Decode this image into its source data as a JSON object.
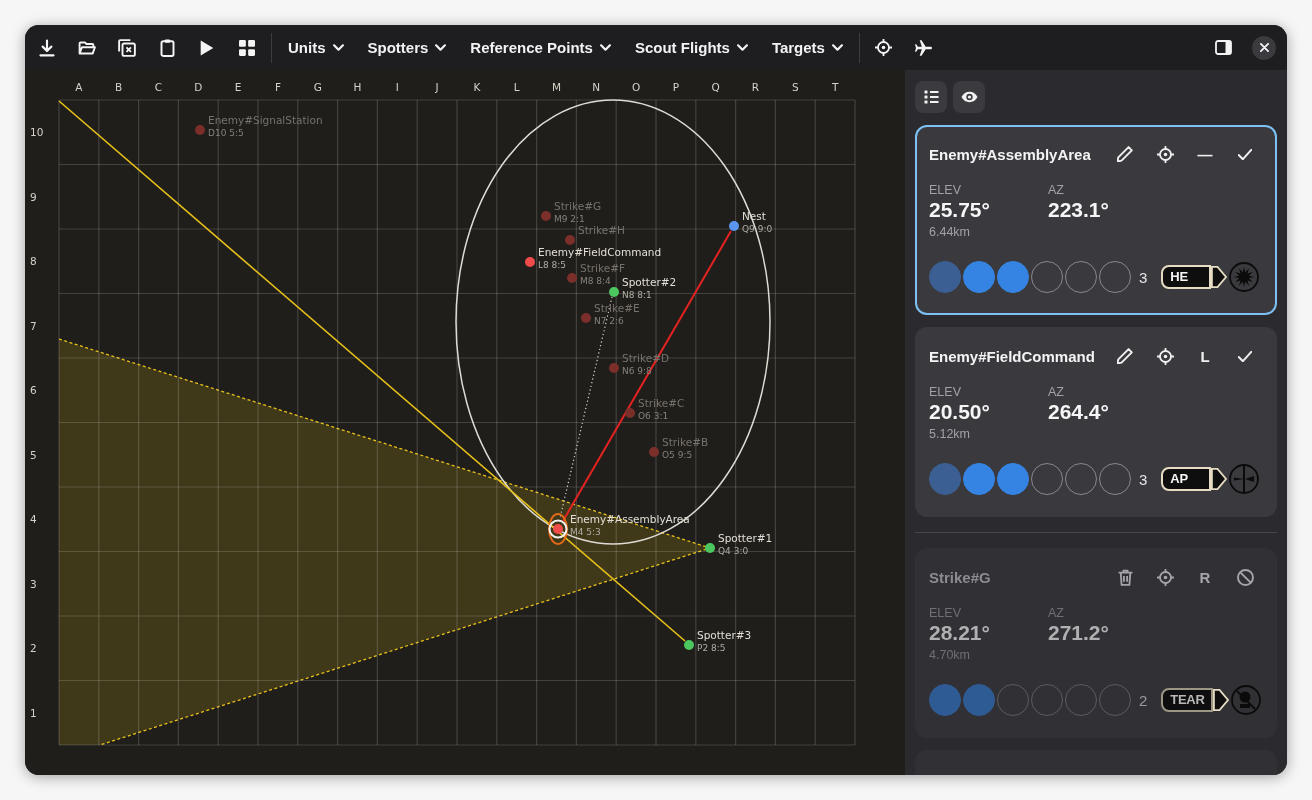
{
  "toolbar": {
    "menus": [
      {
        "label": "Units"
      },
      {
        "label": "Spotters"
      },
      {
        "label": "Reference Points"
      },
      {
        "label": "Scout Flights"
      },
      {
        "label": "Targets"
      }
    ]
  },
  "map": {
    "columns": [
      "A",
      "B",
      "C",
      "D",
      "E",
      "F",
      "G",
      "H",
      "I",
      "J",
      "K",
      "L",
      "M",
      "N",
      "O",
      "P",
      "Q",
      "R",
      "S",
      "T"
    ],
    "rows": [
      "10",
      "9",
      "8",
      "7",
      "6",
      "5",
      "4",
      "3",
      "2",
      "1"
    ],
    "markers": [
      {
        "name": "Enemy#SignalStation",
        "grid": "D10 5:5",
        "color": "#7a2f2b",
        "dimmed": true,
        "selected": false
      },
      {
        "name": "Strike#G",
        "grid": "M9 2:1",
        "color": "#7a2f2b",
        "dimmed": true,
        "selected": false
      },
      {
        "name": "Strike#H",
        "color": "#7a2f2b",
        "dimmed": true,
        "selected": false
      },
      {
        "name": "Enemy#FieldCommand",
        "grid": "L8 8:5",
        "color": "#ef4b4b",
        "dimmed": false,
        "selected": false
      },
      {
        "name": "Strike#F",
        "grid": "M8 8:4",
        "color": "#7a2f2b",
        "dimmed": true,
        "selected": false
      },
      {
        "name": "Spotter#2",
        "grid": "N8 8:1",
        "color": "#4cc760",
        "dimmed": false,
        "selected": false
      },
      {
        "name": "Strike#E",
        "grid": "N7 2:6",
        "color": "#7a2f2b",
        "dimmed": true,
        "selected": false
      },
      {
        "name": "Strike#D",
        "grid": "N6 9:8",
        "color": "#7a2f2b",
        "dimmed": true,
        "selected": false
      },
      {
        "name": "Strike#C",
        "grid": "O6 3:1",
        "color": "#7a2f2b",
        "dimmed": true,
        "selected": false
      },
      {
        "name": "Strike#B",
        "grid": "O5 9:5",
        "color": "#7a2f2b",
        "dimmed": true,
        "selected": false
      },
      {
        "name": "Nest",
        "grid": "Q9 9:0",
        "color": "#5a96f0",
        "dimmed": false,
        "selected": false
      },
      {
        "name": "Enemy#AssemblyArea",
        "grid": "M4 5:3",
        "color": "#ef4b4b",
        "dimmed": false,
        "selected": true
      },
      {
        "name": "Spotter#1",
        "grid": "Q4 3:0",
        "color": "#4cc760",
        "dimmed": false,
        "selected": false
      },
      {
        "name": "Spotter#3",
        "grid": "P2 8:5",
        "color": "#4cc760",
        "dimmed": false,
        "selected": false
      }
    ]
  },
  "panel": {
    "cards": [
      {
        "title": "Enemy#AssemblyArea",
        "kind": "target",
        "selected": true,
        "disabled": false,
        "side": "—",
        "elev_label": "ELEV",
        "elev": "25.75°",
        "range": "6.44km",
        "az_label": "AZ",
        "az": "223.1°",
        "slots": [
          {
            "filled": true,
            "fired": true
          },
          {
            "filled": true,
            "fired": false
          },
          {
            "filled": true,
            "fired": false
          },
          {
            "filled": false,
            "fired": false
          },
          {
            "filled": false,
            "fired": false
          },
          {
            "filled": false,
            "fired": false
          }
        ],
        "count": "3",
        "ammo": {
          "label": "HE",
          "kind": "explosive"
        }
      },
      {
        "title": "Enemy#FieldCommand",
        "kind": "target",
        "selected": false,
        "disabled": false,
        "side": "L",
        "elev_label": "ELEV",
        "elev": "20.50°",
        "range": "5.12km",
        "az_label": "AZ",
        "az": "264.4°",
        "slots": [
          {
            "filled": true,
            "fired": true
          },
          {
            "filled": true,
            "fired": false
          },
          {
            "filled": true,
            "fired": false
          },
          {
            "filled": false,
            "fired": false
          },
          {
            "filled": false,
            "fired": false
          },
          {
            "filled": false,
            "fired": false
          }
        ],
        "count": "3",
        "ammo": {
          "label": "AP",
          "kind": "piercing"
        }
      },
      {
        "title": "Strike#G",
        "kind": "strike",
        "selected": false,
        "disabled": true,
        "side": "R",
        "elev_label": "ELEV",
        "elev": "28.21°",
        "range": "4.70km",
        "az_label": "AZ",
        "az": "271.2°",
        "slots": [
          {
            "filled": true,
            "fired": false
          },
          {
            "filled": true,
            "fired": false
          },
          {
            "filled": false,
            "fired": false
          },
          {
            "filled": false,
            "fired": false
          },
          {
            "filled": false,
            "fired": false
          },
          {
            "filled": false,
            "fired": false
          }
        ],
        "count": "2",
        "ammo": {
          "label": "TEAR",
          "kind": "gas"
        }
      }
    ]
  }
}
